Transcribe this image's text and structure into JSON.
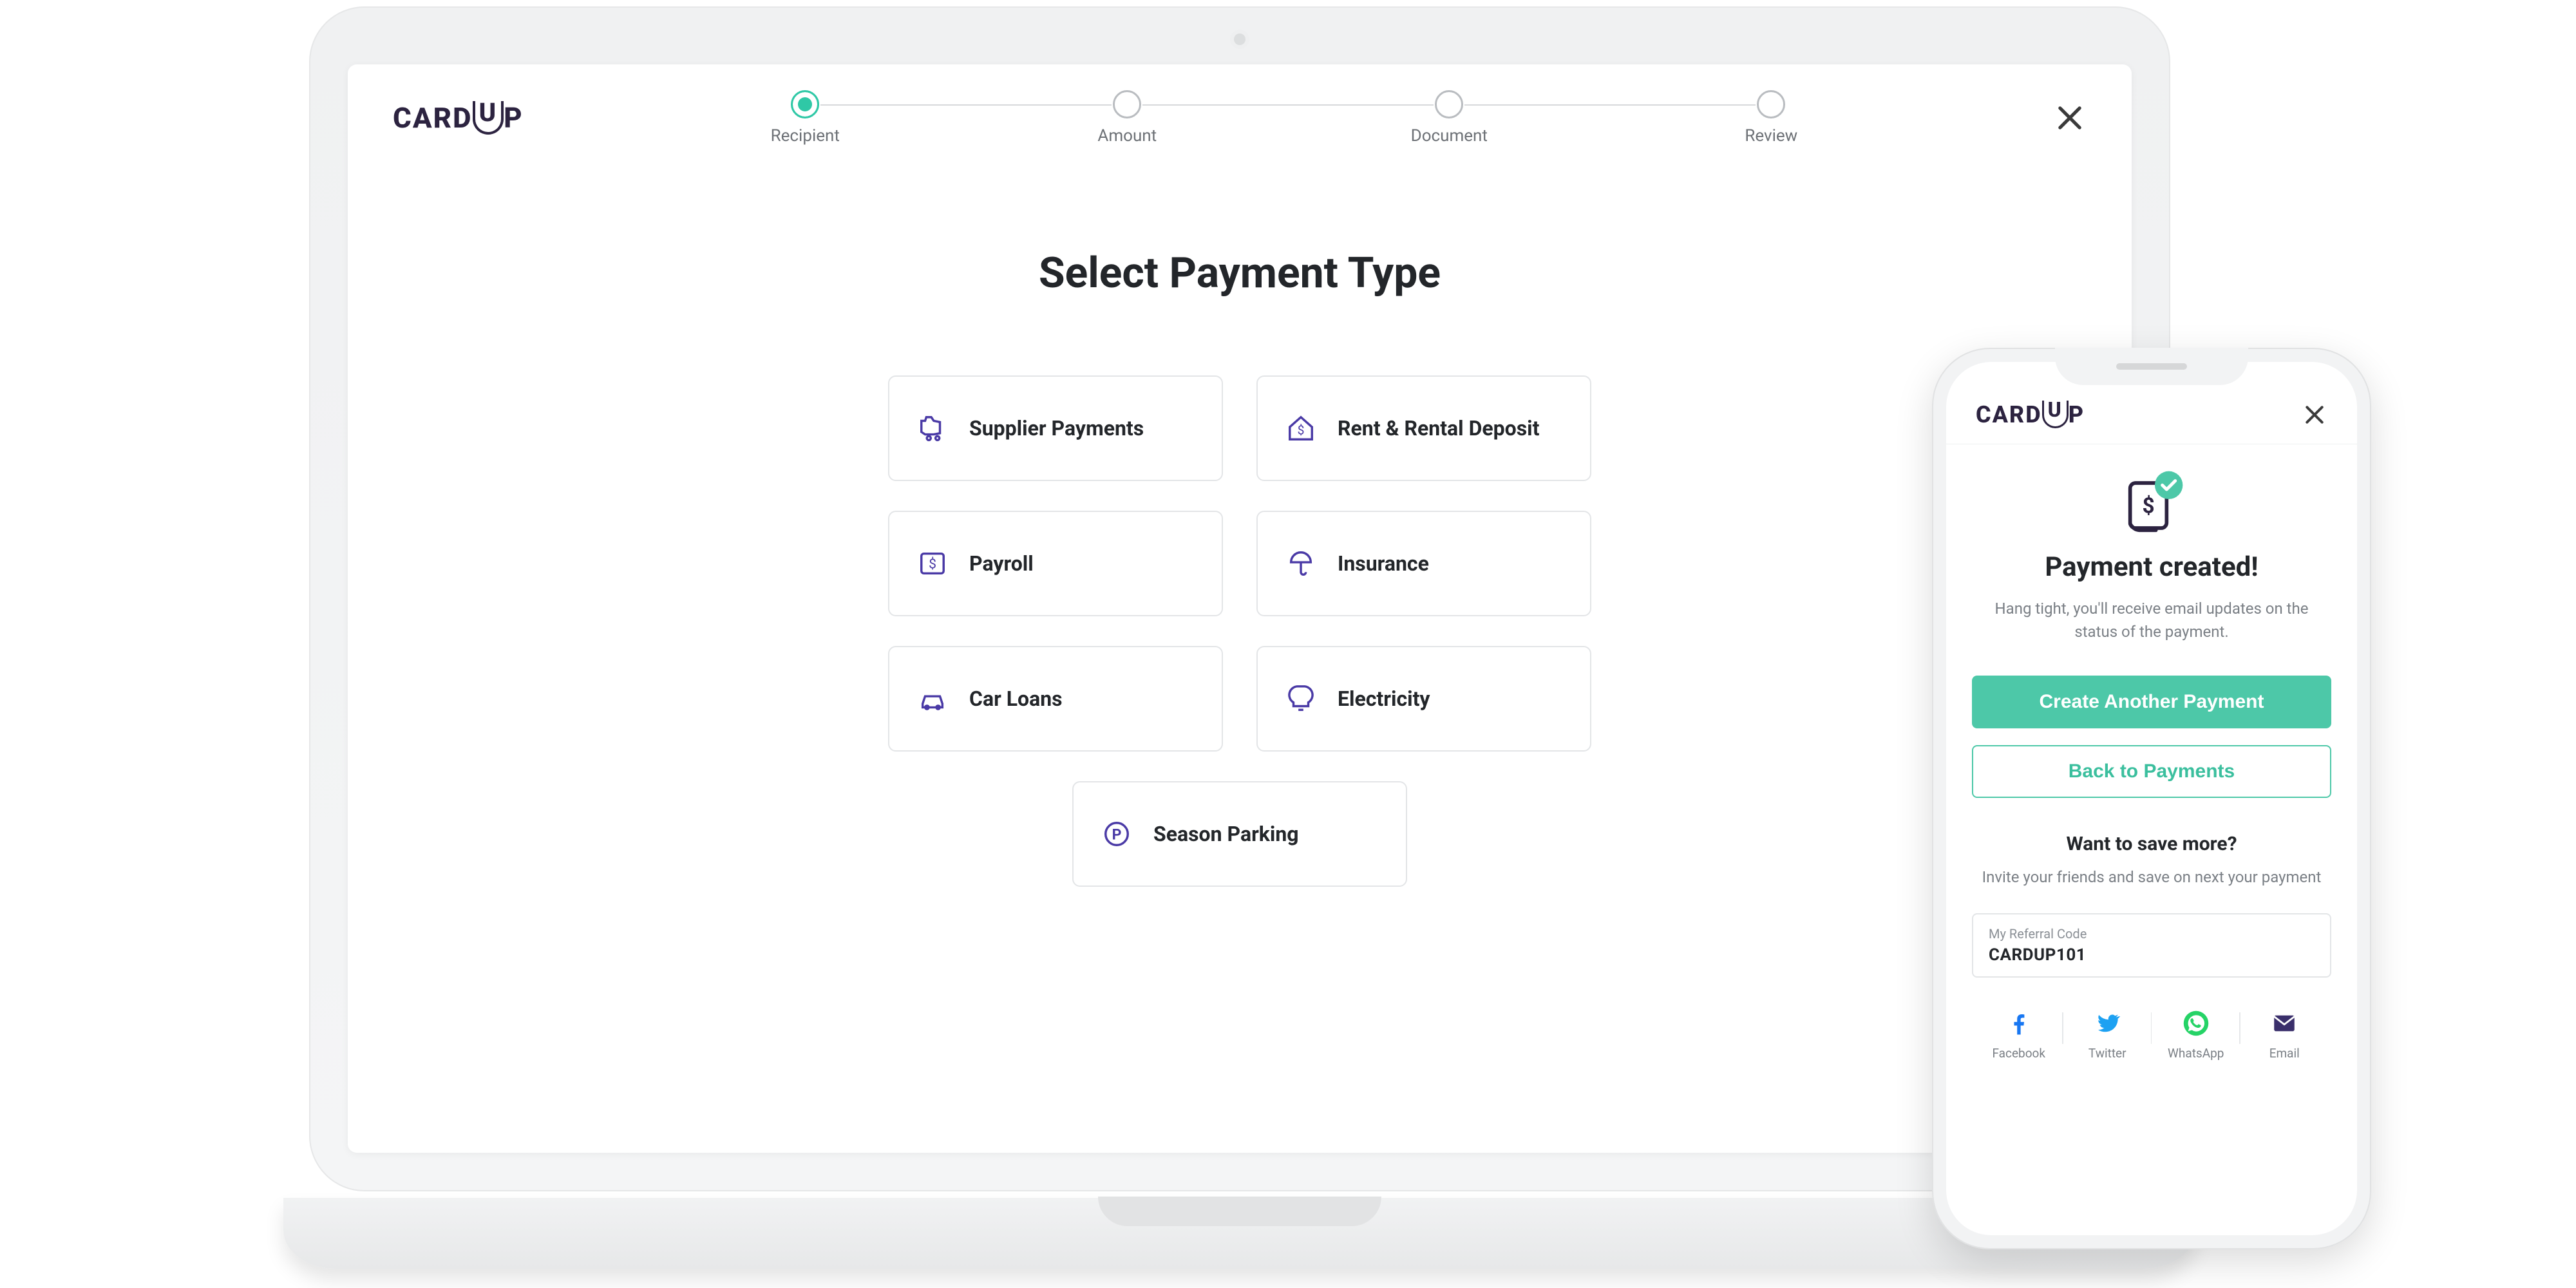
{
  "colors": {
    "accent": "#4dc8a8",
    "iconPurple": "#4a3aa6",
    "text": "#23262a"
  },
  "logo": "CARDUP",
  "laptop": {
    "stepper": [
      {
        "label": "Recipient",
        "active": true
      },
      {
        "label": "Amount",
        "active": false
      },
      {
        "label": "Document",
        "active": false
      },
      {
        "label": "Review",
        "active": false
      }
    ],
    "title": "Select Payment Type",
    "paymentTypes": [
      {
        "label": "Supplier Payments",
        "icon": "supplier"
      },
      {
        "label": "Rent & Rental Deposit",
        "icon": "rent"
      },
      {
        "label": "Payroll",
        "icon": "payroll"
      },
      {
        "label": "Insurance",
        "icon": "insurance"
      },
      {
        "label": "Car Loans",
        "icon": "car"
      },
      {
        "label": "Electricity",
        "icon": "electricity"
      },
      {
        "label": "Season Parking",
        "icon": "parking"
      }
    ]
  },
  "phone": {
    "title": "Payment created!",
    "subtitle": "Hang tight, you'll receive email updates on the status of the payment.",
    "primaryCta": "Create Another Payment",
    "secondaryCta": "Back to Payments",
    "saveTitle": "Want to save more?",
    "saveSubtitle": "Invite your friends and save on next your payment",
    "refLabel": "My Referral Code",
    "refCode": "CARDUP101",
    "share": [
      {
        "label": "Facebook",
        "icon": "facebook",
        "color": "#1877F2"
      },
      {
        "label": "Twitter",
        "icon": "twitter",
        "color": "#1DA1F2"
      },
      {
        "label": "WhatsApp",
        "icon": "whatsapp",
        "color": "#25D366"
      },
      {
        "label": "Email",
        "icon": "email",
        "color": "#3a2f6b"
      }
    ]
  }
}
